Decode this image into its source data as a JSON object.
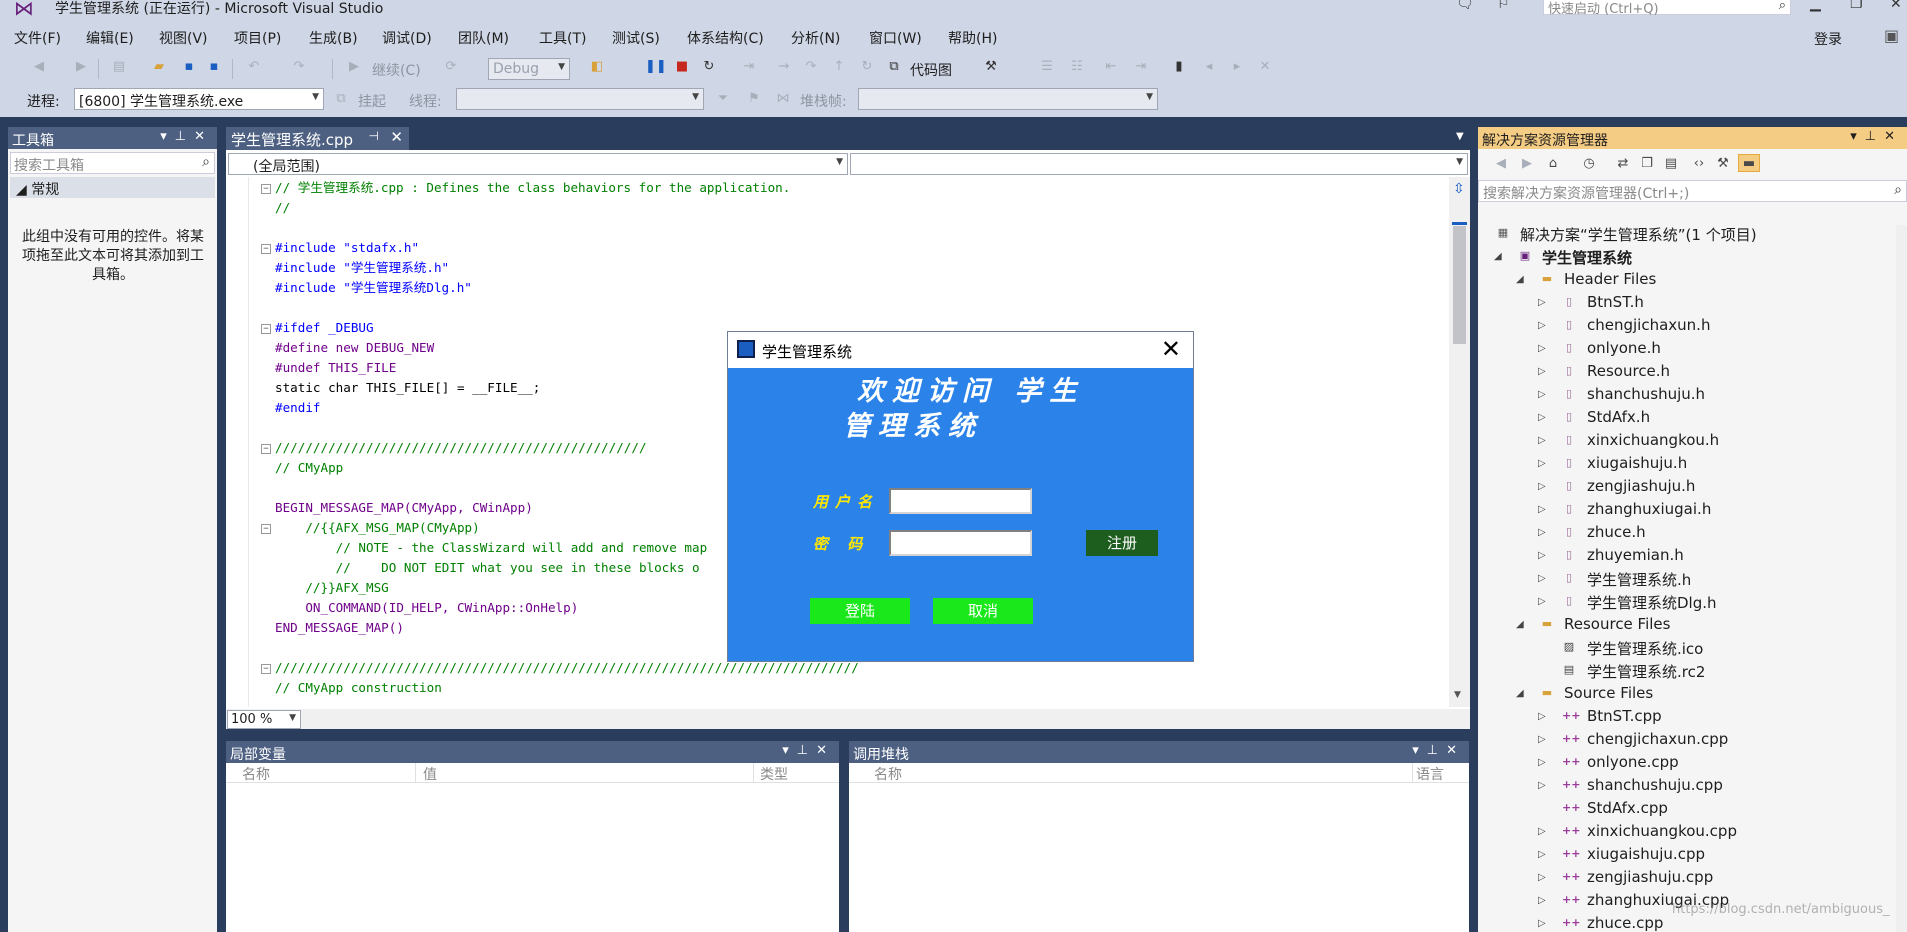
{
  "title_bar": {
    "title": "学生管理系统 (正在运行) - Microsoft Visual Studio",
    "quick_launch_placeholder": "快速启动 (Ctrl+Q)"
  },
  "menu": {
    "items": [
      "文件(F)",
      "编辑(E)",
      "视图(V)",
      "项目(P)",
      "生成(B)",
      "调试(D)",
      "团队(M)",
      "工具(T)",
      "测试(S)",
      "体系结构(C)",
      "分析(N)",
      "窗口(W)",
      "帮助(H)"
    ],
    "login": "登录"
  },
  "toolbar": {
    "continue": "继续(C)",
    "config": "Debug",
    "codemap": "代码图"
  },
  "debug_location": {
    "process_label": "进程:",
    "process_value": "[6800] 学生管理系统.exe",
    "suspend": "挂起",
    "thread_label": "线程:",
    "stack_frame_label": "堆栈帧:"
  },
  "toolbox": {
    "title": "工具箱",
    "search_placeholder": "搜索工具箱",
    "group": "常规",
    "empty_message": "此组中没有可用的控件。将某项拖至此文本可将其添加到工具箱。"
  },
  "editor": {
    "tab": "学生管理系统.cpp",
    "scope": "(全局范围)",
    "zoom": "100 %",
    "lines": [
      "// 学生管理系统.cpp : Defines the class behaviors for the application.",
      "//",
      "",
      "#include \"stdafx.h\"",
      "#include \"学生管理系统.h\"",
      "#include \"学生管理系统Dlg.h\"",
      "",
      "#ifdef _DEBUG",
      "#define new DEBUG_NEW",
      "#undef THIS_FILE",
      "static char THIS_FILE[] = __FILE__;",
      "#endif",
      "",
      "/////////////////////////////////////////////////",
      "// CMyApp",
      "",
      "BEGIN_MESSAGE_MAP(CMyApp, CWinApp)",
      "    //{{AFX_MSG_MAP(CMyApp)",
      "        // NOTE - the ClassWizard will add and remove map",
      "        //    DO NOT EDIT what you see in these blocks o",
      "    //}}AFX_MSG",
      "    ON_COMMAND(ID_HELP, CWinApp::OnHelp)",
      "END_MESSAGE_MAP()",
      "",
      "/////////////////////////////////////////////////////////////////////////////",
      "// CMyApp construction"
    ]
  },
  "locals": {
    "title": "局部变量",
    "columns": [
      "名称",
      "值",
      "类型"
    ]
  },
  "callstack": {
    "title": "调用堆栈",
    "columns": [
      "名称",
      "语言"
    ]
  },
  "dialog": {
    "title": "学生管理系统",
    "welcome_line1": "欢迎访问   学生",
    "welcome_line2": "管理系统",
    "username_label": "用户名",
    "password_label": "密 码",
    "register_button": "注册",
    "login_button": "登陆",
    "cancel_button": "取消"
  },
  "solution_explorer": {
    "title": "解决方案资源管理器",
    "search_placeholder": "搜索解决方案资源管理器(Ctrl+;)",
    "solution": "解决方案“学生管理系统”(1 个项目)",
    "project": "学生管理系统",
    "header_folder": "Header Files",
    "header_files": [
      "BtnST.h",
      "chengjichaxun.h",
      "onlyone.h",
      "Resource.h",
      "shanchushuju.h",
      "StdAfx.h",
      "xinxichuangkou.h",
      "xiugaishuju.h",
      "zengjiashuju.h",
      "zhanghuxiugai.h",
      "zhuce.h",
      "zhuyemian.h",
      "学生管理系统.h",
      "学生管理系统Dlg.h"
    ],
    "resource_folder": "Resource Files",
    "resource_files": [
      "学生管理系统.ico",
      "学生管理系统.rc2"
    ],
    "source_folder": "Source Files",
    "source_files": [
      "BtnST.cpp",
      "chengjichaxun.cpp",
      "onlyone.cpp",
      "shanchushuju.cpp",
      "StdAfx.cpp",
      "xinxichuangkou.cpp",
      "xiugaishuju.cpp",
      "zengjiashuju.cpp",
      "zhanghuxiugai.cpp",
      "zhuce.cpp"
    ]
  },
  "watermark": "https://blog.csdn.net/ambiguous_"
}
